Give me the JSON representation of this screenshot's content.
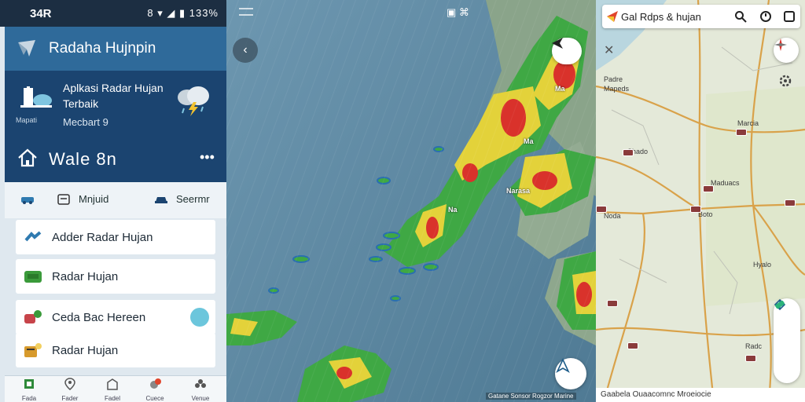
{
  "status_bar": {
    "time": "34R",
    "icons": "8 ▾ ◢ ▮ 133%"
  },
  "app_bar": {
    "title": "Radaha Hujnpin"
  },
  "hero": {
    "headline": "Aplkasi Radar Hujan Terbaik",
    "caption": "Mecbart 9",
    "small_label": "Mapati",
    "home_label": "Wale 8n"
  },
  "quick_actions": [
    {
      "label": "Mnjuid",
      "icon": "calendar-icon"
    },
    {
      "label": "Seermr",
      "icon": "car-icon"
    }
  ],
  "list_items": [
    {
      "label": "Adder Radar Hujan",
      "icon": "cloud-icon",
      "color": "#2f7ab0"
    },
    {
      "label": "Radar Hujan",
      "icon": "radar-icon",
      "color": "#3a9a3a"
    },
    {
      "label": "Ceda Bac Hereen",
      "icon": "layers-icon",
      "color": "#c7444a"
    },
    {
      "label": "Radar Hujan",
      "icon": "storage-icon",
      "color": "#d79a2c"
    }
  ],
  "bottom_nav": [
    {
      "label": "Fada",
      "icon": "home-grid-icon"
    },
    {
      "label": "Fader",
      "icon": "location-pin-icon"
    },
    {
      "label": "Fadel",
      "icon": "building-icon"
    },
    {
      "label": "Cuece",
      "icon": "alert-icon"
    },
    {
      "label": "Venue",
      "icon": "group-icon"
    }
  ],
  "radar": {
    "labels": [
      "Ma",
      "Ma",
      "Narasa",
      "Na"
    ],
    "attribution": "Gatane Sonsor   Rogzor Marine"
  },
  "map": {
    "search_text": "Gal  Rdps & hujan",
    "labels": [
      "Padre",
      "Mapeds",
      "Noda",
      "Maduacs",
      "Hyalo",
      "Marcia",
      "Shado",
      "Boto",
      "Radc"
    ],
    "footer": "Gaabela  Ouaacomnc  Mroeiocie"
  },
  "colors": {
    "app_blue": "#1b4470",
    "accent": "#6cc6dc"
  }
}
